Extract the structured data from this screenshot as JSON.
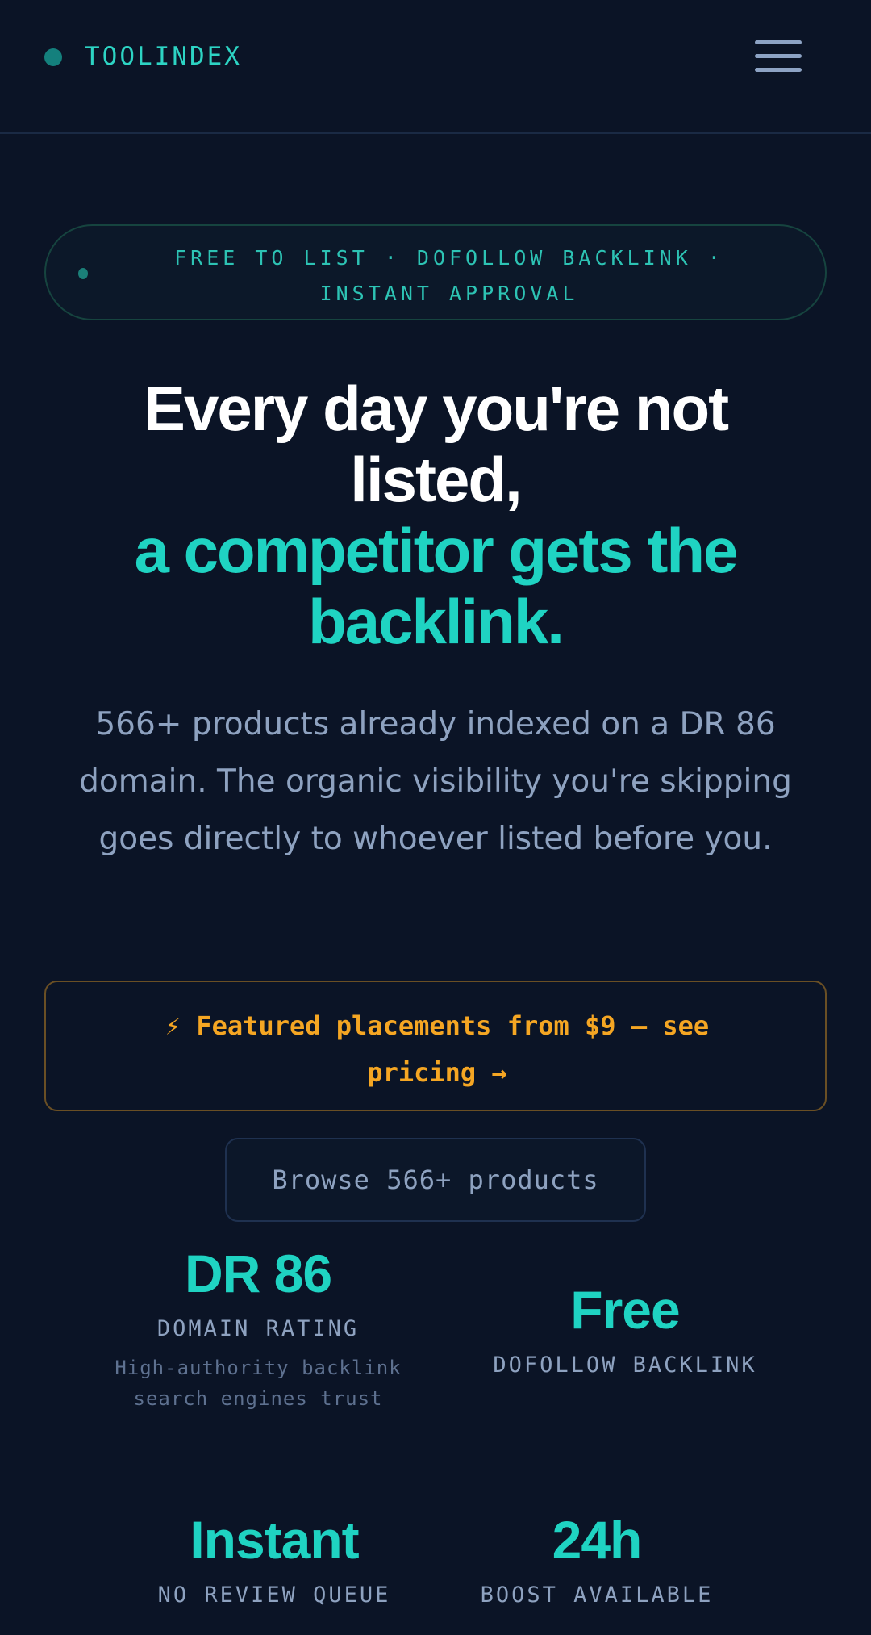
{
  "header": {
    "logo_text": "TOOLINDEX",
    "menu_icon": "hamburger-menu-icon"
  },
  "hero": {
    "badge_text": "FREE TO LIST · DOFOLLOW BACKLINK · INSTANT APPROVAL",
    "headline_white": "Every day you're not listed,",
    "headline_accent": "a competitor gets the backlink.",
    "subtext": "566+ products already indexed on a DR 86 domain. The organic visibility you're skipping goes directly to whoever listed before you."
  },
  "featured_banner": {
    "icon": "lightning-icon",
    "text": "⚡ Featured placements from $9 — see pricing →"
  },
  "browse_button": {
    "label": "Browse 566+ products"
  },
  "stats": [
    {
      "value": "DR 86",
      "label": "DOMAIN RATING",
      "description": "High-authority backlink search engines trust"
    },
    {
      "value": "Free",
      "label": "DOFOLLOW BACKLINK"
    },
    {
      "value": "Instant",
      "label": "NO REVIEW QUEUE"
    },
    {
      "value": "24h",
      "label": "BOOST AVAILABLE"
    }
  ],
  "colors": {
    "background": "#0b1426",
    "accent_teal": "#1fd3c2",
    "accent_amber": "#f5a623",
    "muted_text": "#8ea2c0"
  }
}
